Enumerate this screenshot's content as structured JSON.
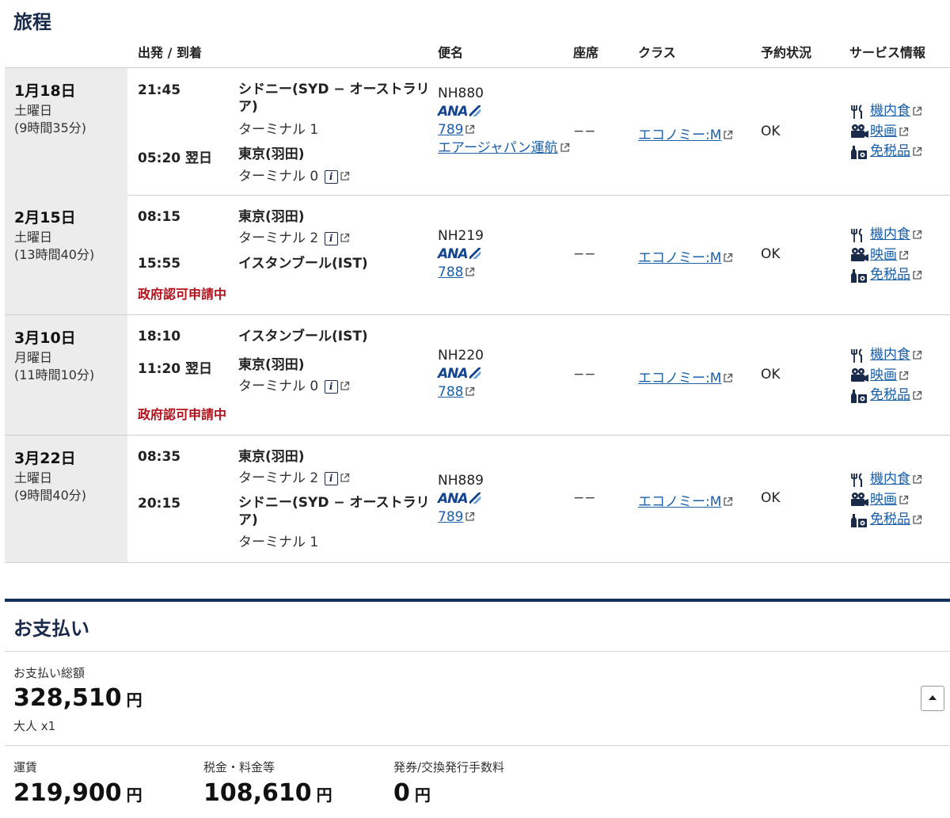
{
  "itinerary": {
    "title": "旅程",
    "headers": {
      "dep_arr": "出発 / 到着",
      "flight": "便名",
      "seat": "座席",
      "class": "クラス",
      "status": "予約状況",
      "service": "サービス情報"
    },
    "flights": [
      {
        "date": "1月18日",
        "day": "土曜日",
        "duration": "(9時間35分)",
        "dep_time": "21:45",
        "dep_airport": "シドニー(SYD − オーストラリア)",
        "dep_terminal": "ターミナル 1",
        "arr_time": "05:20 翌日",
        "arr_airport": "東京(羽田)",
        "arr_terminal": "ターミナル 0",
        "flight_no": "NH880",
        "airline_logo": "ANA",
        "aircraft": "789",
        "operator": "エアージャパン運航",
        "seat": "−−",
        "class": "エコノミー:M",
        "status": "OK",
        "meal": "機内食",
        "movie": "映画",
        "dutyfree": "免税品"
      },
      {
        "date": "2月15日",
        "day": "土曜日",
        "duration": "(13時間40分)",
        "dep_time": "08:15",
        "dep_airport": "東京(羽田)",
        "dep_terminal": "ターミナル 2",
        "arr_time": "15:55",
        "arr_airport": "イスタンブール(IST)",
        "gov_note": "政府認可申請中",
        "flight_no": "NH219",
        "airline_logo": "ANA",
        "aircraft": "788",
        "seat": "−−",
        "class": "エコノミー:M",
        "status": "OK",
        "meal": "機内食",
        "movie": "映画",
        "dutyfree": "免税品"
      },
      {
        "date": "3月10日",
        "day": "月曜日",
        "duration": "(11時間10分)",
        "dep_time": "18:10",
        "dep_airport": "イスタンブール(IST)",
        "arr_time": "11:20 翌日",
        "arr_airport": "東京(羽田)",
        "arr_terminal": "ターミナル 0",
        "gov_note": "政府認可申請中",
        "flight_no": "NH220",
        "airline_logo": "ANA",
        "aircraft": "788",
        "seat": "−−",
        "class": "エコノミー:M",
        "status": "OK",
        "meal": "機内食",
        "movie": "映画",
        "dutyfree": "免税品"
      },
      {
        "date": "3月22日",
        "day": "土曜日",
        "duration": "(9時間40分)",
        "dep_time": "08:35",
        "dep_airport": "東京(羽田)",
        "dep_terminal": "ターミナル 2",
        "arr_time": "20:15",
        "arr_airport": "シドニー(SYD − オーストラリア)",
        "arr_terminal": "ターミナル 1",
        "flight_no": "NH889",
        "airline_logo": "ANA",
        "aircraft": "789",
        "seat": "−−",
        "class": "エコノミー:M",
        "status": "OK",
        "meal": "機内食",
        "movie": "映画",
        "dutyfree": "免税品"
      }
    ]
  },
  "payment": {
    "title": "お支払い",
    "total_label": "お支払い総額",
    "total": "328,510",
    "currency": "円",
    "passengers": "大人 x1",
    "fare_label": "運賃",
    "fare": "219,900",
    "tax_label": "税金・料金等",
    "tax": "108,610",
    "fee_label": "発券/交換発行手数料",
    "fee": "0"
  },
  "icons": {
    "external_link": "external-link-icon",
    "info": "info-icon",
    "meal": "fork-knife-icon",
    "movie": "film-camera-icon",
    "dutyfree": "bottle-gift-icon",
    "collapse": "chevron-up-icon"
  },
  "colors": {
    "navy": "#15305a",
    "link": "#1a5fa8",
    "alert_red": "#b3121c",
    "date_bg": "#ececec"
  }
}
